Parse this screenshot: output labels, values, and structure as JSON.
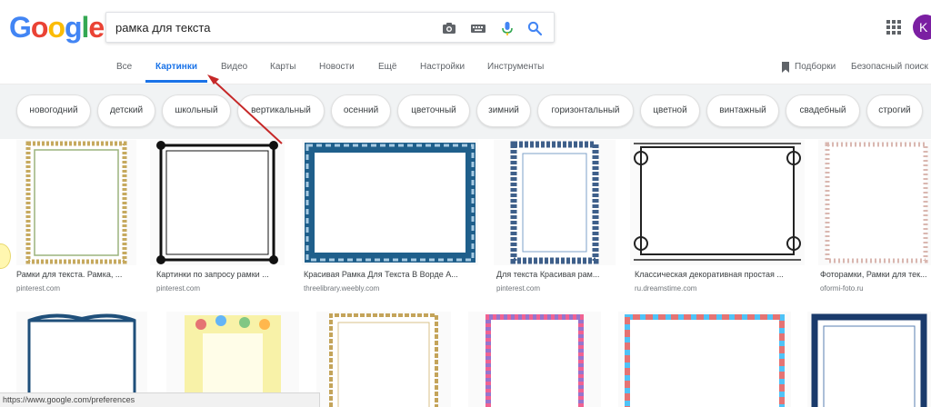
{
  "logo": {
    "letters": [
      "G",
      "o",
      "o",
      "g",
      "l",
      "e"
    ],
    "colors": [
      "#4285F4",
      "#EA4335",
      "#FBBC05",
      "#4285F4",
      "#34A853",
      "#EA4335"
    ]
  },
  "search": {
    "query": "рамка для текста",
    "icons": [
      "camera-icon",
      "keyboard-icon",
      "microphone-icon",
      "search-icon"
    ]
  },
  "account": {
    "avatar_letter": "K",
    "avatar_color": "#7b1fa2"
  },
  "tabs": [
    {
      "label": "Все"
    },
    {
      "label": "Картинки",
      "active": true
    },
    {
      "label": "Видео"
    },
    {
      "label": "Карты"
    },
    {
      "label": "Новости"
    },
    {
      "label": "Ещё"
    },
    {
      "label": "Настройки"
    },
    {
      "label": "Инструменты"
    }
  ],
  "header_right": {
    "bookmarks_label": "Подборки",
    "safesearch_label": "Безопасный поиск"
  },
  "chips": [
    "новогодний",
    "детский",
    "школьный",
    "вертикальный",
    "осенний",
    "цветочный",
    "зимний",
    "горизонтальный",
    "цветной",
    "винтажный",
    "свадебный",
    "строгий"
  ],
  "results_row1": [
    {
      "title": "Рамки для текста. Рамка, ...",
      "source": "pinterest.com"
    },
    {
      "title": "Картинки по запросу рамки ...",
      "source": "pinterest.com"
    },
    {
      "title": "Красивая Рамка Для Текста В Ворде А...",
      "source": "threelibrary.weebly.com"
    },
    {
      "title": "Для текста Красивая рам...",
      "source": "pinterest.com"
    },
    {
      "title": "Классическая декоративная простая ...",
      "source": "ru.dreamstime.com"
    },
    {
      "title": "Фоторамки, Рамки для тек...",
      "source": "oformi-foto.ru"
    }
  ],
  "status_url": "https://www.google.com/preferences",
  "colors": {
    "accent": "#1a73e8",
    "annotation_arrow": "#c62828"
  }
}
